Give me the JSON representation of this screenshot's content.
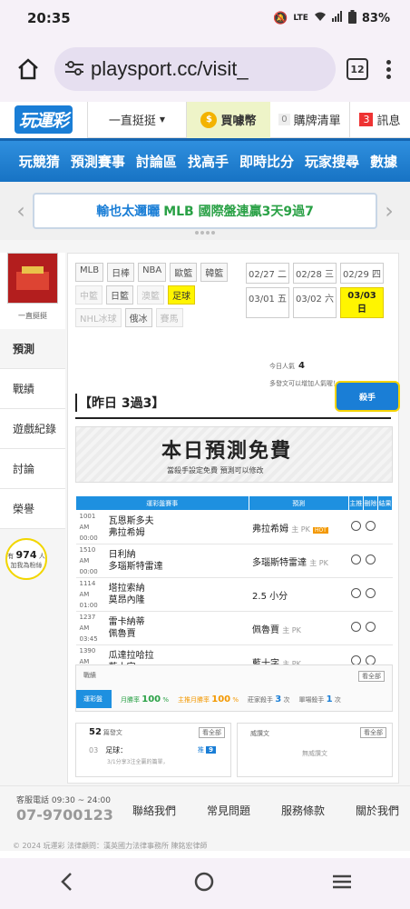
{
  "status": {
    "time": "20:35",
    "battery": "83%",
    "network": "LTE"
  },
  "browser": {
    "url": "playsport.cc/visit_",
    "tab_count": "12"
  },
  "topnav": {
    "logo": "玩運彩",
    "follow": "一直挺挺",
    "coin": "買噱幣",
    "coin_icon": "$",
    "cart_count": "0",
    "cart": "購牌清單",
    "msg_count": "3",
    "msg": "訊息"
  },
  "mainnav": [
    "玩競猜",
    "預測賽事",
    "討論區",
    "找高手",
    "即時比分",
    "玩家搜尋",
    "數據"
  ],
  "banner": {
    "blue": "輸也太邇曬",
    "green": "MLB 國際盤連贏3天9過7"
  },
  "sidebar": {
    "username": "一直挺挺",
    "items": [
      "預測",
      "戰績",
      "遊戲紀錄",
      "討論",
      "榮譽"
    ],
    "fans_prefix": "有",
    "fans_count": "974",
    "fans_suffix": "人",
    "fans_label": "加我為粉絲"
  },
  "tags": [
    {
      "label": "MLB",
      "state": "normal"
    },
    {
      "label": "日棒",
      "state": "normal"
    },
    {
      "label": "NBA",
      "state": "normal"
    },
    {
      "label": "歐籃",
      "state": "normal"
    },
    {
      "label": "韓籃",
      "state": "normal"
    },
    {
      "label": "中籃",
      "state": "dim"
    },
    {
      "label": "日籃",
      "state": "normal"
    },
    {
      "label": "澳籃",
      "state": "dim"
    },
    {
      "label": "足球",
      "state": "selected"
    },
    {
      "label": "NHL冰球",
      "state": "dim"
    },
    {
      "label": "俄冰",
      "state": "normal"
    },
    {
      "label": "賽馬",
      "state": "dim"
    }
  ],
  "dates": [
    {
      "label": "02/27 二",
      "selected": false
    },
    {
      "label": "02/28 三",
      "selected": false
    },
    {
      "label": "02/29 四",
      "selected": false
    },
    {
      "label": "03/01 五",
      "selected": false
    },
    {
      "label": "03/02 六",
      "selected": false
    },
    {
      "label": "03/03 日",
      "selected": true
    }
  ],
  "popularity": {
    "label": "今日人氣",
    "value": "4",
    "note": "多發文可以增加人氣喔！"
  },
  "yesterday": "【昨日 3過3】",
  "top_badge": "殺手",
  "free": {
    "title": "本日預測免費",
    "subtitle": "當殺手設定免費 預測可以修改"
  },
  "table": {
    "headers": [
      "運彩盤賽事",
      "預測",
      "主推",
      "刪除",
      "結果"
    ],
    "rows": [
      {
        "id": "1001",
        "time": "AM 00:00",
        "home": "瓦恩斯多夫",
        "away": "弗拉希姆",
        "pick": "弗拉希姆",
        "note": "主 PK",
        "hot": "HOT"
      },
      {
        "id": "1510",
        "time": "AM 00:00",
        "home": "日利納",
        "away": "多瑙斯特雷達",
        "pick": "多瑙斯特雷達",
        "note": "主 PK",
        "hot": ""
      },
      {
        "id": "1114",
        "time": "AM 01:00",
        "home": "塔拉索納",
        "away": "莫昂內隆",
        "pick": "2.5 小分",
        "note": "",
        "hot": ""
      },
      {
        "id": "1237",
        "time": "AM 03:45",
        "home": "雷卡納蒂",
        "away": "佩魯賈",
        "pick": "佩魯賈",
        "note": "主 PK",
        "hot": ""
      },
      {
        "id": "1390",
        "time": "AM 04:00",
        "home": "瓜達拉哈拉",
        "away": "藍十字",
        "pick": "藍十字",
        "note": "主 PK",
        "hot": ""
      }
    ]
  },
  "record": {
    "head": "戰績",
    "more": "看全部",
    "tab": "運彩盤",
    "month_rate_label": "月勝率",
    "month_rate": "100",
    "unit_pct": "%",
    "main_rate_label": "主推月勝率",
    "main_rate": "100",
    "season_label": "莊家殺手",
    "season_value": "3",
    "unit_times": "次",
    "single_label": "單場殺手",
    "single_value": "1"
  },
  "posts": {
    "count": "52",
    "title": "篇發文",
    "more": "看全部",
    "no": "03",
    "topic": "足球：",
    "snippet": "3/1分享3注全贏的篇單，",
    "push_label": "推",
    "push": "9"
  },
  "wins": {
    "title": "威讚文",
    "more": "看全部",
    "empty": "無威讚文"
  },
  "footer": {
    "label": "客服電話 09:30 ~ 24:00",
    "phone": "07-9700123",
    "links": [
      "聯絡我們",
      "常見問題",
      "服務條款",
      "關於我們"
    ],
    "copy": "© 2024 玩運彩 法律顧問：漢英國力法律事務所 陳銘宏律師"
  }
}
